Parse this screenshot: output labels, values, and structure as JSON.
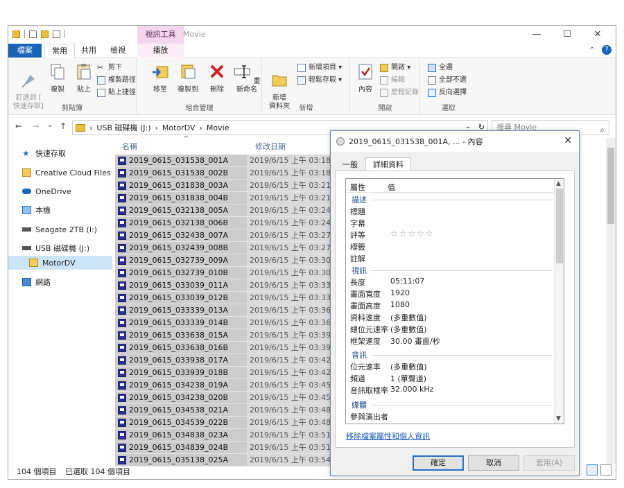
{
  "titlebar": {
    "context_tab": "視訊工具",
    "window_title": "Movie",
    "min": "—",
    "max": "☐",
    "close": "✕"
  },
  "ribbon_tabs": {
    "file": "檔案",
    "home": "常用",
    "share": "共用",
    "view": "檢視",
    "play": "播放",
    "collapse": "^",
    "help": "?"
  },
  "ribbon": {
    "clipboard": {
      "name": "剪貼簿",
      "pin": "釘選到 [\n快速存取]",
      "copy": "複製",
      "paste": "貼上",
      "cut": "剪下",
      "copy_path": "複製路徑",
      "paste_shortcut": "貼上捷徑"
    },
    "organize": {
      "name": "組合管理",
      "move_to": "移至",
      "copy_to": "複製到",
      "delete": "刪除",
      "rename": "重新命名"
    },
    "new": {
      "name": "新增",
      "new_folder": "新增\n資料夾",
      "new_item": "新增項目 ▾",
      "easy_access": "輕鬆存取 ▾"
    },
    "open": {
      "name": "開啟",
      "properties": "內容",
      "open": "開啟 ▾",
      "edit": "編輯",
      "history": "歷程記錄"
    },
    "select": {
      "name": "選取",
      "select_all": "全選",
      "select_none": "全部不選",
      "invert": "反向選擇"
    }
  },
  "address": {
    "back": "←",
    "forward": "→",
    "recent": "⌄",
    "up": "↑",
    "sep": "›",
    "path": [
      "USB 磁碟機 (J:)",
      "MotorDV",
      "Movie"
    ],
    "dropdown": "⌄",
    "refresh": "↻",
    "search_placeholder": "搜尋 Movie",
    "search_icon": "⌕"
  },
  "nav": [
    {
      "label": "快速存取"
    },
    {
      "label": "Creative Cloud Files"
    },
    {
      "label": "OneDrive"
    },
    {
      "label": "本機"
    },
    {
      "label": "Seagate 2TB (I:)"
    },
    {
      "label": "USB 磁碟機 (J:)"
    },
    {
      "label": "MotorDV"
    },
    {
      "label": "網路"
    }
  ],
  "columns": {
    "name": "名稱",
    "sort": "^",
    "date": "修改日期"
  },
  "files": [
    {
      "name": "2019_0615_031538_001A",
      "date": "2019/6/15 上午 03:18"
    },
    {
      "name": "2019_0615_031538_002B",
      "date": "2019/6/15 上午 03:18"
    },
    {
      "name": "2019_0615_031838_003A",
      "date": "2019/6/15 上午 03:21"
    },
    {
      "name": "2019_0615_031838_004B",
      "date": "2019/6/15 上午 03:21"
    },
    {
      "name": "2019_0615_032138_005A",
      "date": "2019/6/15 上午 03:24"
    },
    {
      "name": "2019_0615_032138_006B",
      "date": "2019/6/15 上午 03:24"
    },
    {
      "name": "2019_0615_032438_007A",
      "date": "2019/6/15 上午 03:27"
    },
    {
      "name": "2019_0615_032439_008B",
      "date": "2019/6/15 上午 03:27"
    },
    {
      "name": "2019_0615_032739_009A",
      "date": "2019/6/15 上午 03:30"
    },
    {
      "name": "2019_0615_032739_010B",
      "date": "2019/6/15 上午 03:30"
    },
    {
      "name": "2019_0615_033039_011A",
      "date": "2019/6/15 上午 03:33"
    },
    {
      "name": "2019_0615_033039_012B",
      "date": "2019/6/15 上午 03:33"
    },
    {
      "name": "2019_0615_033339_013A",
      "date": "2019/6/15 上午 03:36"
    },
    {
      "name": "2019_0615_033339_014B",
      "date": "2019/6/15 上午 03:36"
    },
    {
      "name": "2019_0615_033638_015A",
      "date": "2019/6/15 上午 03:39"
    },
    {
      "name": "2019_0615_033638_016B",
      "date": "2019/6/15 上午 03:39"
    },
    {
      "name": "2019_0615_033938_017A",
      "date": "2019/6/15 上午 03:42"
    },
    {
      "name": "2019_0615_033939_018B",
      "date": "2019/6/15 上午 03:42"
    },
    {
      "name": "2019_0615_034238_019A",
      "date": "2019/6/15 上午 03:45"
    },
    {
      "name": "2019_0615_034238_020B",
      "date": "2019/6/15 上午 03:45"
    },
    {
      "name": "2019_0615_034538_021A",
      "date": "2019/6/15 上午 03:48"
    },
    {
      "name": "2019_0615_034539_022B",
      "date": "2019/6/15 上午 03:48"
    },
    {
      "name": "2019_0615_034838_023A",
      "date": "2019/6/15 上午 03:51"
    },
    {
      "name": "2019_0615_034839_024B",
      "date": "2019/6/15 上午 03:51"
    },
    {
      "name": "2019_0615_035138_025A",
      "date": "2019/6/15 上午 03:54"
    }
  ],
  "status": {
    "count": "104 個項目",
    "selected": "已選取 104 個項目"
  },
  "dialog": {
    "title": "2019_0615_031538_001A, ... - 內容",
    "close": "✕",
    "tab_general": "一般",
    "tab_details": "詳細資料",
    "col_property": "屬性",
    "col_value": "值",
    "sections": {
      "desc": "描述",
      "video": "視訊",
      "audio": "音訊",
      "media": "媒體"
    },
    "desc_rows": [
      "標題",
      "字幕",
      "評等",
      "標籤",
      "註解"
    ],
    "rating": "☆☆☆☆☆",
    "video_rows": [
      {
        "k": "長度",
        "v": "05:11:07"
      },
      {
        "k": "畫面寬度",
        "v": "1920"
      },
      {
        "k": "畫面高度",
        "v": "1080"
      },
      {
        "k": "資料速度",
        "v": "(多重數值)"
      },
      {
        "k": "總位元速率",
        "v": "(多重數值)"
      },
      {
        "k": "框架速度",
        "v": "30.00 畫面/秒"
      }
    ],
    "audio_rows": [
      {
        "k": "位元速率",
        "v": "(多重數值)"
      },
      {
        "k": "頻道",
        "v": "1 (單聲道)"
      },
      {
        "k": "音訊取樣率",
        "v": "32.000 kHz"
      }
    ],
    "media_partial": "參與演出者",
    "link": "移除檔案屬性和個人資訊",
    "ok": "確定",
    "cancel": "取消",
    "apply": "套用(A)",
    "scroll_up": "▲",
    "scroll_down": "▼"
  },
  "colors": {
    "accent": "#1a64b8",
    "selection": "#cccccc",
    "nav_selected": "#cce4f7"
  }
}
